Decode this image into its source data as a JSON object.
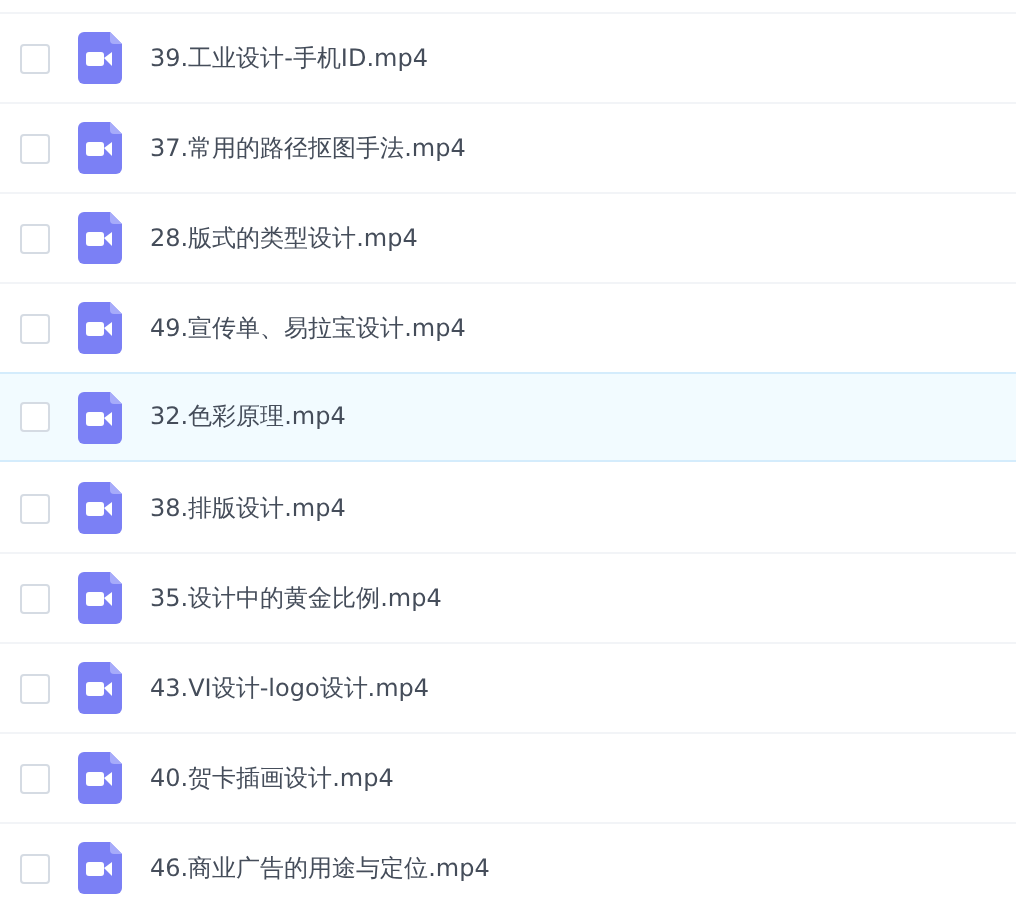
{
  "files": [
    {
      "name": "39.工业设计-手机ID.mp4",
      "highlighted": false,
      "checked": false
    },
    {
      "name": "37.常用的路径抠图手法.mp4",
      "highlighted": false,
      "checked": false
    },
    {
      "name": "28.版式的类型设计.mp4",
      "highlighted": false,
      "checked": false
    },
    {
      "name": "49.宣传单、易拉宝设计.mp4",
      "highlighted": false,
      "checked": false
    },
    {
      "name": "32.色彩原理.mp4",
      "highlighted": true,
      "checked": false
    },
    {
      "name": "38.排版设计.mp4",
      "highlighted": false,
      "checked": false
    },
    {
      "name": "35.设计中的黄金比例.mp4",
      "highlighted": false,
      "checked": false
    },
    {
      "name": "43.VI设计-logo设计.mp4",
      "highlighted": false,
      "checked": false
    },
    {
      "name": "40.贺卡插画设计.mp4",
      "highlighted": false,
      "checked": false
    },
    {
      "name": "46.商业广告的用途与定位.mp4",
      "highlighted": false,
      "checked": false
    }
  ]
}
